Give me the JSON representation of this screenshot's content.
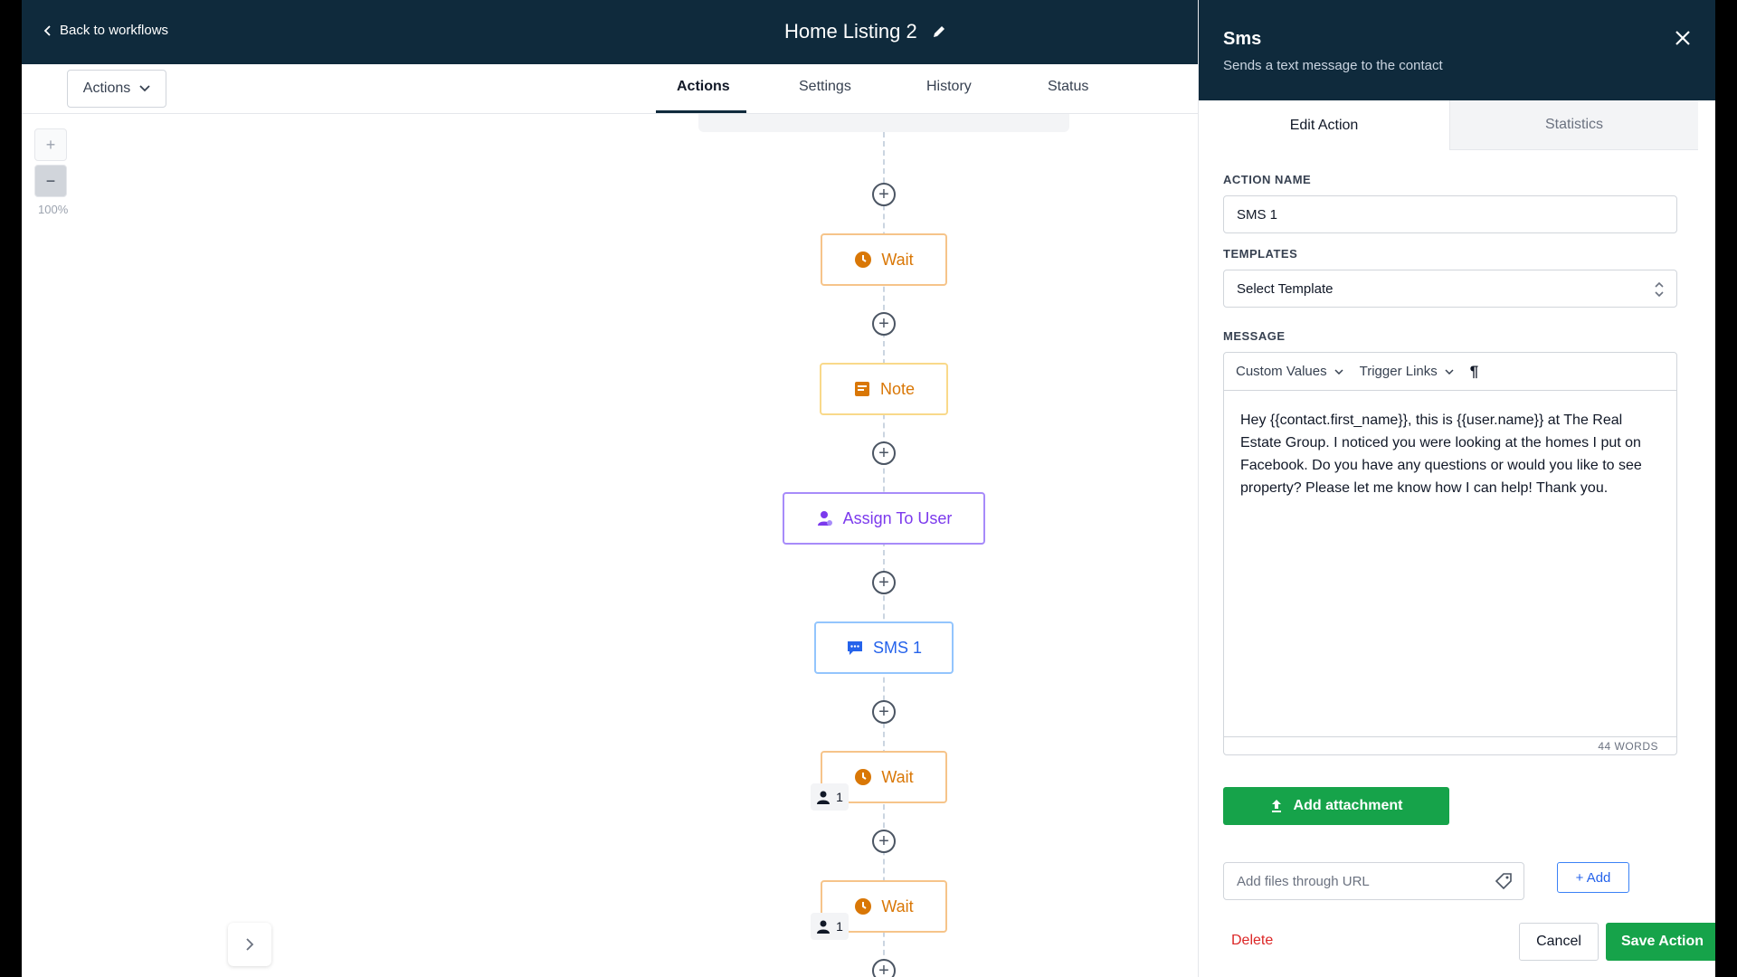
{
  "header": {
    "back_label": "Back to workflows",
    "workflow_title": "Home Listing 2"
  },
  "subbar": {
    "actions_dropdown": "Actions",
    "tabs": [
      {
        "label": "Actions",
        "active": true
      },
      {
        "label": "Settings",
        "active": false
      },
      {
        "label": "History",
        "active": false
      },
      {
        "label": "Status",
        "active": false
      }
    ]
  },
  "zoom": {
    "plus": "+",
    "minus": "−",
    "level": "100%"
  },
  "flow": {
    "nodes": [
      {
        "label": "Wait",
        "type": "wait",
        "icon": "clock-icon"
      },
      {
        "label": "Note",
        "type": "note",
        "icon": "note-icon"
      },
      {
        "label": "Assign To User",
        "type": "assign",
        "icon": "user-assign-icon"
      },
      {
        "label": "SMS 1",
        "type": "sms",
        "icon": "chat-icon"
      },
      {
        "label": "Wait",
        "type": "wait",
        "icon": "clock-icon",
        "count": "1"
      },
      {
        "label": "Wait",
        "type": "wait",
        "icon": "clock-icon",
        "count": "1"
      }
    ],
    "add_symbol": "+"
  },
  "panel": {
    "title": "Sms",
    "subtitle": "Sends a text message to the contact",
    "tabs": [
      {
        "label": "Edit Action",
        "active": true
      },
      {
        "label": "Statistics",
        "active": false
      }
    ],
    "action_name_label": "ACTION NAME",
    "action_name_value": "SMS 1",
    "templates_label": "TEMPLATES",
    "templates_value": "Select Template",
    "message_label": "MESSAGE",
    "toolbar": {
      "custom_values": "Custom Values",
      "trigger_links": "Trigger Links",
      "paragraph": "¶"
    },
    "message_text": "Hey {{contact.first_name}}, this is {{user.name}} at The Real Estate Group. I noticed you were looking at the homes I put on Facebook. Do you have any questions or would you like to see property? Please let me know how I can help! Thank you.",
    "word_count": "44 WORDS",
    "attach_label": "Add attachment",
    "url_placeholder": "Add files through URL",
    "add_label": "+ Add",
    "delete_label": "Delete",
    "cancel_label": "Cancel",
    "save_label": "Save Action"
  },
  "colors": {
    "header_bg": "#0f2a3c",
    "save_green": "#16a34a",
    "wait_orange": "#d97706",
    "assign_purple": "#7c3aed",
    "sms_blue": "#2563eb"
  }
}
